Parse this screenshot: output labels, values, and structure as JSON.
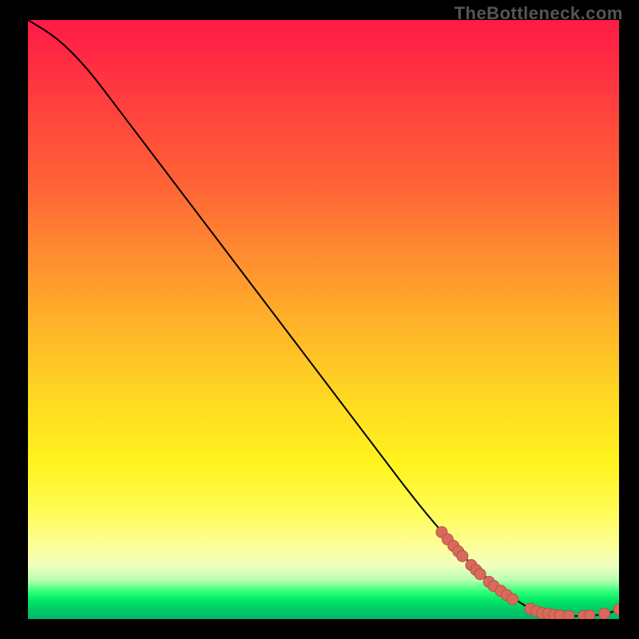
{
  "watermark": "TheBottleneck.com",
  "colors": {
    "curve_stroke": "#000000",
    "marker_fill": "#d86a5d",
    "marker_stroke": "#b9513f"
  },
  "chart_data": {
    "type": "line",
    "title": "",
    "xlabel": "",
    "ylabel": "",
    "xlim": [
      0,
      100
    ],
    "ylim": [
      0,
      100
    ],
    "grid": false,
    "legend": false,
    "series": [
      {
        "name": "curve",
        "x": [
          0,
          5,
          10,
          15,
          20,
          25,
          30,
          35,
          40,
          45,
          50,
          55,
          60,
          65,
          70,
          75,
          80,
          84,
          86,
          88,
          90,
          92,
          94,
          96,
          98,
          100
        ],
        "y": [
          100,
          97,
          92,
          85.5,
          79,
          72.5,
          66,
          59.5,
          53,
          46.5,
          40,
          33.5,
          27,
          20.5,
          14.5,
          9,
          5,
          2.2,
          1.4,
          0.9,
          0.6,
          0.5,
          0.5,
          0.6,
          0.9,
          1.6
        ]
      }
    ],
    "markers": [
      {
        "x": 70,
        "y": 14.5
      },
      {
        "x": 71,
        "y": 13.3
      },
      {
        "x": 72,
        "y": 12.2
      },
      {
        "x": 72.8,
        "y": 11.3
      },
      {
        "x": 73.5,
        "y": 10.5
      },
      {
        "x": 75,
        "y": 9.0
      },
      {
        "x": 75.8,
        "y": 8.2
      },
      {
        "x": 76.5,
        "y": 7.5
      },
      {
        "x": 78,
        "y": 6.2
      },
      {
        "x": 78.8,
        "y": 5.5
      },
      {
        "x": 80,
        "y": 4.7
      },
      {
        "x": 81,
        "y": 4.0
      },
      {
        "x": 82,
        "y": 3.3
      },
      {
        "x": 85,
        "y": 1.7
      },
      {
        "x": 86,
        "y": 1.3
      },
      {
        "x": 87,
        "y": 1.0
      },
      {
        "x": 88,
        "y": 0.9
      },
      {
        "x": 89,
        "y": 0.7
      },
      {
        "x": 90,
        "y": 0.6
      },
      {
        "x": 91.5,
        "y": 0.5
      },
      {
        "x": 94,
        "y": 0.5
      },
      {
        "x": 95,
        "y": 0.6
      },
      {
        "x": 97.5,
        "y": 0.9
      },
      {
        "x": 100,
        "y": 1.6
      }
    ]
  }
}
